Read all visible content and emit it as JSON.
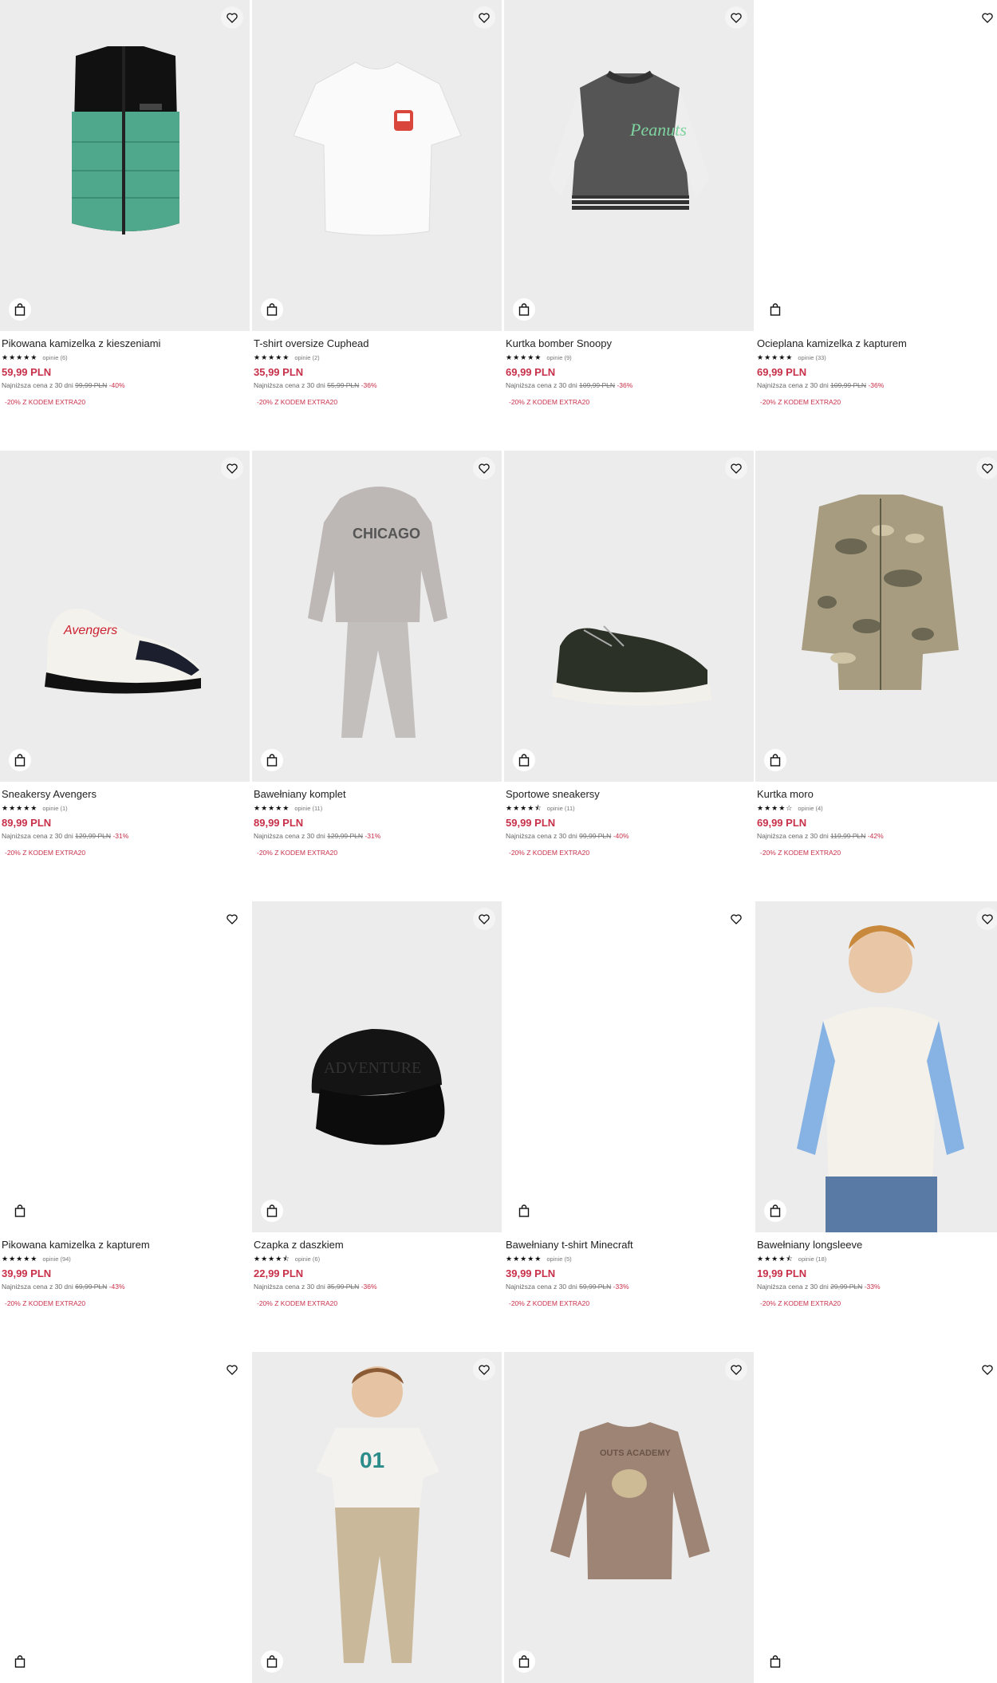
{
  "products": [
    {
      "name": "Pikowana kamizelka z kieszeniami",
      "stars": "★★★★★",
      "reviews": "opinie (6)",
      "price": "59,99 PLN",
      "lowest_label": "Najniższa cena z 30 dni",
      "old_price": "99,99 PLN",
      "discount": "-40%",
      "promo": "-20% Z KODEM EXTRA20",
      "art": "vest-green"
    },
    {
      "name": "T-shirt oversize Cuphead",
      "stars": "★★★★★",
      "reviews": "opinie (2)",
      "price": "35,99 PLN",
      "lowest_label": "Najniższa cena z 30 dni",
      "old_price": "55,99 PLN",
      "discount": "-36%",
      "promo": "-20% Z KODEM EXTRA20",
      "art": "tshirt-white"
    },
    {
      "name": "Kurtka bomber Snoopy",
      "stars": "★★★★★",
      "reviews": "opinie (9)",
      "price": "69,99 PLN",
      "lowest_label": "Najniższa cena z 30 dni",
      "old_price": "109,99 PLN",
      "discount": "-36%",
      "promo": "-20% Z KODEM EXTRA20",
      "art": "bomber"
    },
    {
      "name": "Ocieplana kamizelka z kapturem",
      "stars": "★★★★★",
      "reviews": "opinie (33)",
      "price": "69,99 PLN",
      "lowest_label": "Najniższa cena z 30 dni",
      "old_price": "109,99 PLN",
      "discount": "-36%",
      "promo": "-20% Z KODEM EXTRA20",
      "art": "blank"
    },
    {
      "name": "Sneakersy Avengers",
      "stars": "★★★★★",
      "reviews": "opinie (1)",
      "price": "89,99 PLN",
      "lowest_label": "Najniższa cena z 30 dni",
      "old_price": "129,99 PLN",
      "discount": "-31%",
      "promo": "-20% Z KODEM EXTRA20",
      "art": "sneaker-white"
    },
    {
      "name": "Bawełniany komplet",
      "stars": "★★★★★",
      "reviews": "opinie (11)",
      "price": "89,99 PLN",
      "lowest_label": "Najniższa cena z 30 dni",
      "old_price": "129,99 PLN",
      "discount": "-31%",
      "promo": "-20% Z KODEM EXTRA20",
      "art": "tracksuit"
    },
    {
      "name": "Sportowe sneakersy",
      "stars": "★★★★⯪",
      "reviews": "opinie (11)",
      "price": "59,99 PLN",
      "lowest_label": "Najniższa cena z 30 dni",
      "old_price": "99,99 PLN",
      "discount": "-40%",
      "promo": "-20% Z KODEM EXTRA20",
      "art": "sneaker-dark"
    },
    {
      "name": "Kurtka moro",
      "stars": "★★★★☆",
      "reviews": "opinie (4)",
      "price": "69,99 PLN",
      "lowest_label": "Najniższa cena z 30 dni",
      "old_price": "119,99 PLN",
      "discount": "-42%",
      "promo": "-20% Z KODEM EXTRA20",
      "art": "camo"
    },
    {
      "name": "Pikowana kamizelka z kapturem",
      "stars": "★★★★★",
      "reviews": "opinie (94)",
      "price": "39,99 PLN",
      "lowest_label": "Najniższa cena z 30 dni",
      "old_price": "69,99 PLN",
      "discount": "-43%",
      "promo": "-20% Z KODEM EXTRA20",
      "art": "blank"
    },
    {
      "name": "Czapka z daszkiem",
      "stars": "★★★★⯪",
      "reviews": "opinie (6)",
      "price": "22,99 PLN",
      "lowest_label": "Najniższa cena z 30 dni",
      "old_price": "35,99 PLN",
      "discount": "-36%",
      "promo": "-20% Z KODEM EXTRA20",
      "art": "cap"
    },
    {
      "name": "Bawełniany t-shirt Minecraft",
      "stars": "★★★★★",
      "reviews": "opinie (5)",
      "price": "39,99 PLN",
      "lowest_label": "Najniższa cena z 30 dni",
      "old_price": "59,99 PLN",
      "discount": "-33%",
      "promo": "-20% Z KODEM EXTRA20",
      "art": "blank"
    },
    {
      "name": "Bawełniany longsleeve",
      "stars": "★★★★⯪",
      "reviews": "opinie (18)",
      "price": "19,99 PLN",
      "lowest_label": "Najniższa cena z 30 dni",
      "old_price": "29,99 PLN",
      "discount": "-33%",
      "promo": "-20% Z KODEM EXTRA20",
      "art": "boy-longsleeve"
    },
    {
      "art": "blank"
    },
    {
      "art": "boy-tee"
    },
    {
      "art": "brown-longsleeve"
    },
    {
      "art": "blank"
    }
  ]
}
